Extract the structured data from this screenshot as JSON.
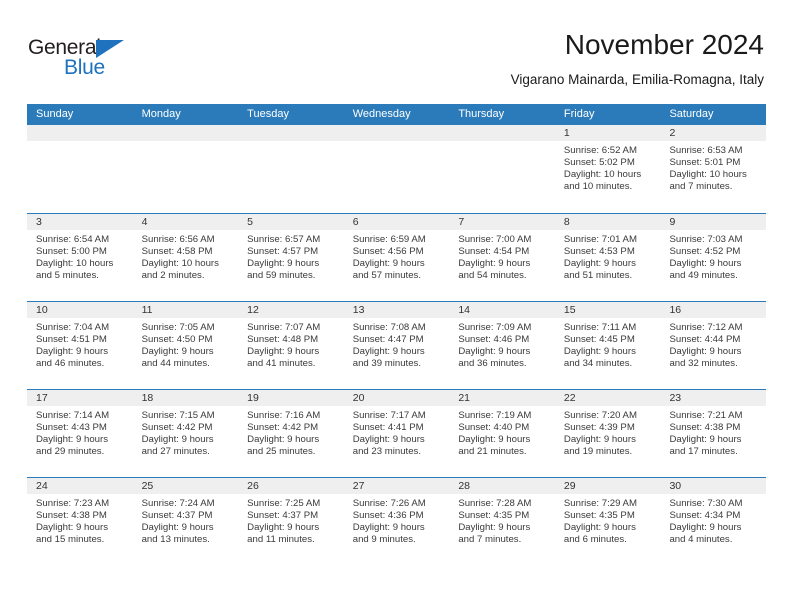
{
  "brand": {
    "name_top": "General",
    "name_bottom": "Blue",
    "accent_color": "#1f72bd"
  },
  "header": {
    "title": "November 2024",
    "subtitle": "Vigarano Mainarda, Emilia-Romagna, Italy"
  },
  "calendar": {
    "header_color": "#2b7bba",
    "weekdays": [
      "Sunday",
      "Monday",
      "Tuesday",
      "Wednesday",
      "Thursday",
      "Friday",
      "Saturday"
    ],
    "weeks": [
      [
        {
          "day": "",
          "sunrise": "",
          "sunset": "",
          "daylight_line1": "",
          "daylight_line2": ""
        },
        {
          "day": "",
          "sunrise": "",
          "sunset": "",
          "daylight_line1": "",
          "daylight_line2": ""
        },
        {
          "day": "",
          "sunrise": "",
          "sunset": "",
          "daylight_line1": "",
          "daylight_line2": ""
        },
        {
          "day": "",
          "sunrise": "",
          "sunset": "",
          "daylight_line1": "",
          "daylight_line2": ""
        },
        {
          "day": "",
          "sunrise": "",
          "sunset": "",
          "daylight_line1": "",
          "daylight_line2": ""
        },
        {
          "day": "1",
          "sunrise": "Sunrise: 6:52 AM",
          "sunset": "Sunset: 5:02 PM",
          "daylight_line1": "Daylight: 10 hours",
          "daylight_line2": "and 10 minutes."
        },
        {
          "day": "2",
          "sunrise": "Sunrise: 6:53 AM",
          "sunset": "Sunset: 5:01 PM",
          "daylight_line1": "Daylight: 10 hours",
          "daylight_line2": "and 7 minutes."
        }
      ],
      [
        {
          "day": "3",
          "sunrise": "Sunrise: 6:54 AM",
          "sunset": "Sunset: 5:00 PM",
          "daylight_line1": "Daylight: 10 hours",
          "daylight_line2": "and 5 minutes."
        },
        {
          "day": "4",
          "sunrise": "Sunrise: 6:56 AM",
          "sunset": "Sunset: 4:58 PM",
          "daylight_line1": "Daylight: 10 hours",
          "daylight_line2": "and 2 minutes."
        },
        {
          "day": "5",
          "sunrise": "Sunrise: 6:57 AM",
          "sunset": "Sunset: 4:57 PM",
          "daylight_line1": "Daylight: 9 hours",
          "daylight_line2": "and 59 minutes."
        },
        {
          "day": "6",
          "sunrise": "Sunrise: 6:59 AM",
          "sunset": "Sunset: 4:56 PM",
          "daylight_line1": "Daylight: 9 hours",
          "daylight_line2": "and 57 minutes."
        },
        {
          "day": "7",
          "sunrise": "Sunrise: 7:00 AM",
          "sunset": "Sunset: 4:54 PM",
          "daylight_line1": "Daylight: 9 hours",
          "daylight_line2": "and 54 minutes."
        },
        {
          "day": "8",
          "sunrise": "Sunrise: 7:01 AM",
          "sunset": "Sunset: 4:53 PM",
          "daylight_line1": "Daylight: 9 hours",
          "daylight_line2": "and 51 minutes."
        },
        {
          "day": "9",
          "sunrise": "Sunrise: 7:03 AM",
          "sunset": "Sunset: 4:52 PM",
          "daylight_line1": "Daylight: 9 hours",
          "daylight_line2": "and 49 minutes."
        }
      ],
      [
        {
          "day": "10",
          "sunrise": "Sunrise: 7:04 AM",
          "sunset": "Sunset: 4:51 PM",
          "daylight_line1": "Daylight: 9 hours",
          "daylight_line2": "and 46 minutes."
        },
        {
          "day": "11",
          "sunrise": "Sunrise: 7:05 AM",
          "sunset": "Sunset: 4:50 PM",
          "daylight_line1": "Daylight: 9 hours",
          "daylight_line2": "and 44 minutes."
        },
        {
          "day": "12",
          "sunrise": "Sunrise: 7:07 AM",
          "sunset": "Sunset: 4:48 PM",
          "daylight_line1": "Daylight: 9 hours",
          "daylight_line2": "and 41 minutes."
        },
        {
          "day": "13",
          "sunrise": "Sunrise: 7:08 AM",
          "sunset": "Sunset: 4:47 PM",
          "daylight_line1": "Daylight: 9 hours",
          "daylight_line2": "and 39 minutes."
        },
        {
          "day": "14",
          "sunrise": "Sunrise: 7:09 AM",
          "sunset": "Sunset: 4:46 PM",
          "daylight_line1": "Daylight: 9 hours",
          "daylight_line2": "and 36 minutes."
        },
        {
          "day": "15",
          "sunrise": "Sunrise: 7:11 AM",
          "sunset": "Sunset: 4:45 PM",
          "daylight_line1": "Daylight: 9 hours",
          "daylight_line2": "and 34 minutes."
        },
        {
          "day": "16",
          "sunrise": "Sunrise: 7:12 AM",
          "sunset": "Sunset: 4:44 PM",
          "daylight_line1": "Daylight: 9 hours",
          "daylight_line2": "and 32 minutes."
        }
      ],
      [
        {
          "day": "17",
          "sunrise": "Sunrise: 7:14 AM",
          "sunset": "Sunset: 4:43 PM",
          "daylight_line1": "Daylight: 9 hours",
          "daylight_line2": "and 29 minutes."
        },
        {
          "day": "18",
          "sunrise": "Sunrise: 7:15 AM",
          "sunset": "Sunset: 4:42 PM",
          "daylight_line1": "Daylight: 9 hours",
          "daylight_line2": "and 27 minutes."
        },
        {
          "day": "19",
          "sunrise": "Sunrise: 7:16 AM",
          "sunset": "Sunset: 4:42 PM",
          "daylight_line1": "Daylight: 9 hours",
          "daylight_line2": "and 25 minutes."
        },
        {
          "day": "20",
          "sunrise": "Sunrise: 7:17 AM",
          "sunset": "Sunset: 4:41 PM",
          "daylight_line1": "Daylight: 9 hours",
          "daylight_line2": "and 23 minutes."
        },
        {
          "day": "21",
          "sunrise": "Sunrise: 7:19 AM",
          "sunset": "Sunset: 4:40 PM",
          "daylight_line1": "Daylight: 9 hours",
          "daylight_line2": "and 21 minutes."
        },
        {
          "day": "22",
          "sunrise": "Sunrise: 7:20 AM",
          "sunset": "Sunset: 4:39 PM",
          "daylight_line1": "Daylight: 9 hours",
          "daylight_line2": "and 19 minutes."
        },
        {
          "day": "23",
          "sunrise": "Sunrise: 7:21 AM",
          "sunset": "Sunset: 4:38 PM",
          "daylight_line1": "Daylight: 9 hours",
          "daylight_line2": "and 17 minutes."
        }
      ],
      [
        {
          "day": "24",
          "sunrise": "Sunrise: 7:23 AM",
          "sunset": "Sunset: 4:38 PM",
          "daylight_line1": "Daylight: 9 hours",
          "daylight_line2": "and 15 minutes."
        },
        {
          "day": "25",
          "sunrise": "Sunrise: 7:24 AM",
          "sunset": "Sunset: 4:37 PM",
          "daylight_line1": "Daylight: 9 hours",
          "daylight_line2": "and 13 minutes."
        },
        {
          "day": "26",
          "sunrise": "Sunrise: 7:25 AM",
          "sunset": "Sunset: 4:37 PM",
          "daylight_line1": "Daylight: 9 hours",
          "daylight_line2": "and 11 minutes."
        },
        {
          "day": "27",
          "sunrise": "Sunrise: 7:26 AM",
          "sunset": "Sunset: 4:36 PM",
          "daylight_line1": "Daylight: 9 hours",
          "daylight_line2": "and 9 minutes."
        },
        {
          "day": "28",
          "sunrise": "Sunrise: 7:28 AM",
          "sunset": "Sunset: 4:35 PM",
          "daylight_line1": "Daylight: 9 hours",
          "daylight_line2": "and 7 minutes."
        },
        {
          "day": "29",
          "sunrise": "Sunrise: 7:29 AM",
          "sunset": "Sunset: 4:35 PM",
          "daylight_line1": "Daylight: 9 hours",
          "daylight_line2": "and 6 minutes."
        },
        {
          "day": "30",
          "sunrise": "Sunrise: 7:30 AM",
          "sunset": "Sunset: 4:34 PM",
          "daylight_line1": "Daylight: 9 hours",
          "daylight_line2": "and 4 minutes."
        }
      ]
    ]
  }
}
